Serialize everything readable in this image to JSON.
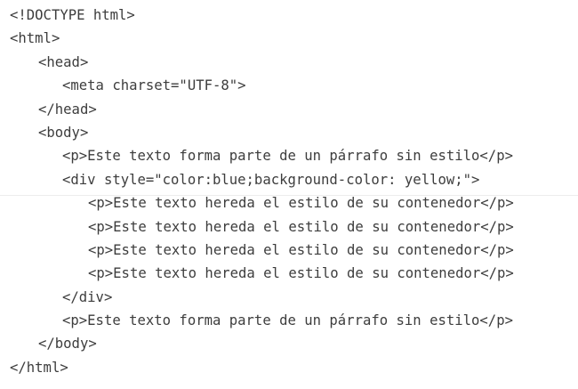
{
  "code": {
    "lines": [
      {
        "text": "<!DOCTYPE html>",
        "indent": 0
      },
      {
        "text": "<html>",
        "indent": 0
      },
      {
        "text": "<head>",
        "indent": 1
      },
      {
        "text": "<meta charset=\"UTF-8\">",
        "indent": 2
      },
      {
        "text": "</head>",
        "indent": 1
      },
      {
        "text": "<body>",
        "indent": 1
      },
      {
        "text": "<p>Este texto forma parte de un párrafo sin estilo</p>",
        "indent": 2
      },
      {
        "text": "<div style=\"color:blue;background-color: yellow;\">",
        "indent": 2
      },
      {
        "text": "<p>Este texto hereda el estilo de su contenedor</p>",
        "indent": 3
      },
      {
        "text": "<p>Este texto hereda el estilo de su contenedor</p>",
        "indent": 3
      },
      {
        "text": "<p>Este texto hereda el estilo de su contenedor</p>",
        "indent": 3
      },
      {
        "text": "<p>Este texto hereda el estilo de su contenedor</p>",
        "indent": 3
      },
      {
        "text": "</div>",
        "indent": 2
      },
      {
        "text": "<p>Este texto forma parte de un párrafo sin estilo</p>",
        "indent": 2
      },
      {
        "text": "</body>",
        "indent": 1
      },
      {
        "text": "</html>",
        "indent": 0
      }
    ]
  },
  "colors": {
    "text": "#3d3d3d",
    "background": "#ffffff"
  }
}
